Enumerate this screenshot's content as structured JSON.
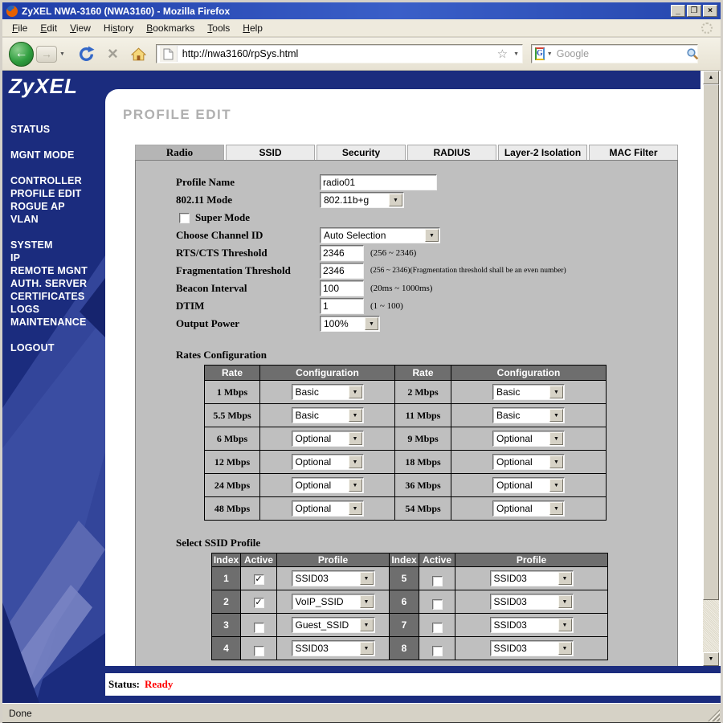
{
  "window": {
    "title": "ZyXEL NWA-3160 (NWA3160) - Mozilla Firefox",
    "minimize": "_",
    "maximize": "❐",
    "close": "×"
  },
  "menubar": [
    {
      "pre": "",
      "accel": "F",
      "post": "ile"
    },
    {
      "pre": "",
      "accel": "E",
      "post": "dit"
    },
    {
      "pre": "",
      "accel": "V",
      "post": "iew"
    },
    {
      "pre": "Hi",
      "accel": "s",
      "post": "tory"
    },
    {
      "pre": "",
      "accel": "B",
      "post": "ookmarks"
    },
    {
      "pre": "",
      "accel": "T",
      "post": "ools"
    },
    {
      "pre": "",
      "accel": "H",
      "post": "elp"
    }
  ],
  "toolbar": {
    "url": "http://nwa3160/rpSys.html",
    "search_placeholder": "Google"
  },
  "sidebar": {
    "logo": "ZyXEL",
    "groups": [
      [
        "STATUS"
      ],
      [
        "MGNT MODE"
      ],
      [
        "CONTROLLER",
        "PROFILE EDIT",
        "ROGUE AP",
        "VLAN"
      ],
      [
        "SYSTEM",
        "IP",
        "REMOTE MGNT",
        "AUTH. SERVER",
        "CERTIFICATES",
        "LOGS",
        "MAINTENANCE"
      ],
      [
        "LOGOUT"
      ]
    ]
  },
  "page": {
    "title": "PROFILE EDIT",
    "tabs": [
      "Radio",
      "SSID",
      "Security",
      "RADIUS",
      "Layer-2 Isolation",
      "MAC Filter"
    ],
    "active_tab": "Radio",
    "form": {
      "profile_name": {
        "label": "Profile Name",
        "value": "radio01"
      },
      "mode": {
        "label": "802.11 Mode",
        "value": "802.11b+g"
      },
      "super_mode": {
        "label": "Super Mode",
        "checked": ""
      },
      "channel": {
        "label": "Choose Channel ID",
        "value": "Auto Selection"
      },
      "rts": {
        "label": "RTS/CTS Threshold",
        "value": "2346",
        "hint": "(256 ~ 2346)"
      },
      "frag": {
        "label": "Fragmentation Threshold",
        "value": "2346",
        "hint": "(256 ~ 2346)(Fragmentation threshold shall be an even number)"
      },
      "beacon": {
        "label": "Beacon Interval",
        "value": "100",
        "hint": "(20ms ~ 1000ms)"
      },
      "dtim": {
        "label": "DTIM",
        "value": "1",
        "hint": "(1 ~ 100)"
      },
      "power": {
        "label": "Output Power",
        "value": "100%"
      }
    },
    "rates": {
      "title": "Rates Configuration",
      "headers": [
        "Rate",
        "Configuration",
        "Rate",
        "Configuration"
      ],
      "rows": [
        {
          "r1": "1 Mbps",
          "c1": "Basic",
          "r2": "2 Mbps",
          "c2": "Basic"
        },
        {
          "r1": "5.5 Mbps",
          "c1": "Basic",
          "r2": "11 Mbps",
          "c2": "Basic"
        },
        {
          "r1": "6 Mbps",
          "c1": "Optional",
          "r2": "9 Mbps",
          "c2": "Optional"
        },
        {
          "r1": "12 Mbps",
          "c1": "Optional",
          "r2": "18 Mbps",
          "c2": "Optional"
        },
        {
          "r1": "24 Mbps",
          "c1": "Optional",
          "r2": "36 Mbps",
          "c2": "Optional"
        },
        {
          "r1": "48 Mbps",
          "c1": "Optional",
          "r2": "54 Mbps",
          "c2": "Optional"
        }
      ]
    },
    "ssid": {
      "title": "Select SSID Profile",
      "headers": [
        "Index",
        "Active",
        "Profile",
        "Index",
        "Active",
        "Profile"
      ],
      "rows": [
        {
          "i1": "1",
          "a1": "✓",
          "p1": "SSID03",
          "i2": "5",
          "a2": "",
          "p2": "SSID03"
        },
        {
          "i1": "2",
          "a1": "✓",
          "p1": "VoIP_SSID",
          "i2": "6",
          "a2": "",
          "p2": "SSID03"
        },
        {
          "i1": "3",
          "a1": "",
          "p1": "Guest_SSID",
          "i2": "7",
          "a2": "",
          "p2": "SSID03"
        },
        {
          "i1": "4",
          "a1": "",
          "p1": "SSID03",
          "i2": "8",
          "a2": "",
          "p2": "SSID03"
        }
      ]
    },
    "status": {
      "label": "Status:",
      "value": "Ready"
    }
  },
  "statusbar": {
    "text": "Done"
  }
}
